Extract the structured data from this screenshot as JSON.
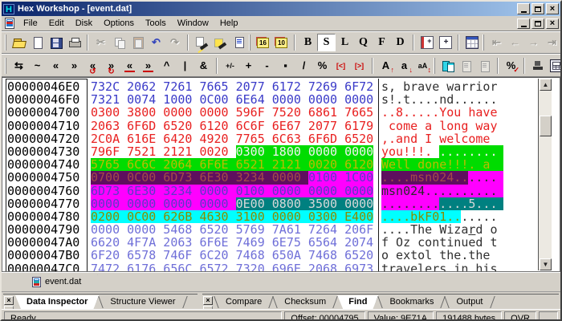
{
  "window": {
    "title": "Hex Workshop - [event.dat]",
    "logo_letter": "H"
  },
  "menu": {
    "items": [
      "File",
      "Edit",
      "Disk",
      "Options",
      "Tools",
      "Window",
      "Help"
    ]
  },
  "doc_tab": {
    "label": "event.dat"
  },
  "colors": {
    "title_gradient_left": "#0a246a",
    "title_gradient_right": "#a6caf0",
    "chrome": "#d4d0c8",
    "hex_blue": "#3a3ac8",
    "hex_periwinkle": "#6f6fd8",
    "hex_red": "#e82020",
    "green_bg": "#00dc00",
    "green_text_yellow": "#bcbc00",
    "magenta_bg": "#ff00ff",
    "magenta_text": "#5a3ac8",
    "purple_bg": "#5e0f5e",
    "purple_text": "#a34a4a",
    "teal_bg": "#008080",
    "teal_text": "#d8d8d8",
    "cyan_bg": "#00ffff",
    "cyan_text": "#8a8a00",
    "ascii_dim": "#303030"
  },
  "toolbar_row1": [
    {
      "k": "grip"
    },
    {
      "n": "open-button",
      "i": "open"
    },
    {
      "n": "new-button",
      "i": "new"
    },
    {
      "n": "save-button",
      "i": "save"
    },
    {
      "n": "print-button",
      "i": "print"
    },
    {
      "k": "sep"
    },
    {
      "n": "cut-button",
      "g": "✂",
      "d": 1
    },
    {
      "n": "copy-button",
      "i": "copy",
      "d": 1
    },
    {
      "n": "paste-button",
      "i": "paste",
      "d": 1
    },
    {
      "n": "undo-button",
      "g": "↶",
      "c": "#3344bb"
    },
    {
      "n": "redo-button",
      "g": "↷",
      "d": 1
    },
    {
      "k": "sep"
    },
    {
      "n": "find-button",
      "i": "flash"
    },
    {
      "n": "replace-button",
      "i": "flash2"
    },
    {
      "n": "copy-special-button",
      "i": "copyspec"
    },
    {
      "k": "grip"
    },
    {
      "n": "hex-base-button",
      "k": "box",
      "g": "16"
    },
    {
      "n": "dec-base-button",
      "k": "box",
      "g": "10"
    },
    {
      "k": "sep"
    },
    {
      "n": "byte-button",
      "k": "ltr",
      "g": "B"
    },
    {
      "n": "short-button",
      "k": "ltr",
      "g": "S",
      "p": 1
    },
    {
      "n": "long-button",
      "k": "ltr",
      "g": "L"
    },
    {
      "n": "quad-button",
      "k": "ltr",
      "g": "Q"
    },
    {
      "n": "float-button",
      "k": "ltr",
      "g": "F"
    },
    {
      "n": "double-button",
      "k": "ltr",
      "g": "D"
    },
    {
      "k": "sep"
    },
    {
      "n": "insert-remove-button",
      "i": "bookpm"
    },
    {
      "n": "insert-button",
      "i": "bookp"
    },
    {
      "k": "sep"
    },
    {
      "n": "grid-view-button",
      "i": "grid"
    },
    {
      "k": "grip"
    },
    {
      "n": "goto-first-button",
      "g": "⇤",
      "d": 1
    },
    {
      "n": "go-back-button",
      "g": "←",
      "d": 1
    },
    {
      "n": "go-forward-button",
      "g": "→",
      "d": 1
    },
    {
      "n": "goto-last-button",
      "g": "⇥",
      "d": 1
    }
  ],
  "toolbar_row2": [
    {
      "k": "grip"
    },
    {
      "n": "swap-bytes-button",
      "g": "⇆"
    },
    {
      "n": "not-button",
      "g": "~"
    },
    {
      "n": "shift-left-button",
      "g": "«"
    },
    {
      "n": "shift-right-button",
      "g": "»"
    },
    {
      "n": "rotate-left-button",
      "g": "«",
      "ab": "↺"
    },
    {
      "n": "rotate-right-button",
      "g": "»",
      "ab": "↻"
    },
    {
      "n": "roll-left-button",
      "g": "«",
      "ul": 1
    },
    {
      "n": "roll-right-button",
      "g": "»",
      "ul": 1
    },
    {
      "n": "xor-button",
      "g": "^"
    },
    {
      "n": "or-button",
      "g": "|"
    },
    {
      "n": "and-button",
      "g": "&"
    },
    {
      "k": "sep"
    },
    {
      "n": "negate-button",
      "g": "+/-",
      "sm": 1
    },
    {
      "n": "add-button",
      "g": "+"
    },
    {
      "n": "subtract-button",
      "g": "-"
    },
    {
      "n": "multiply-button",
      "g": "▪"
    },
    {
      "n": "divide-button",
      "g": "/"
    },
    {
      "n": "modulus-button",
      "g": "%"
    },
    {
      "n": "block-shift-left-button",
      "g": "[<]",
      "sm": 1,
      "red": 1
    },
    {
      "n": "block-shift-right-button",
      "g": "[>]",
      "sm": 1,
      "red": 1
    },
    {
      "k": "sep"
    },
    {
      "n": "uppercase-button",
      "g": "A",
      "a": "↑"
    },
    {
      "n": "lowercase-button",
      "g": "a",
      "a": "↓"
    },
    {
      "n": "toggle-case-button",
      "g": "aA",
      "sm": 1,
      "a": "↕"
    },
    {
      "k": "grip"
    },
    {
      "n": "compare-files-button",
      "i": "compare"
    },
    {
      "n": "compare-prev-button",
      "i": "comppage",
      "d": 1
    },
    {
      "n": "compare-next-button",
      "i": "comppage",
      "d": 1
    },
    {
      "k": "sep"
    },
    {
      "n": "checksum-button",
      "g": "%",
      "a": "✓"
    },
    {
      "k": "sep"
    },
    {
      "n": "smart-map-button",
      "i": "stamp"
    },
    {
      "n": "calculator-button",
      "i": "calc"
    }
  ],
  "editor": {
    "rows": [
      {
        "a": "00000046E0",
        "h": [
          [
            "732C 2062 7261 7665 2077 6172 7269 6F72",
            "blue"
          ]
        ],
        "s": [
          [
            "s, brave warrior",
            "dim"
          ]
        ]
      },
      {
        "a": "00000046F0",
        "h": [
          [
            "7321 0074 1000 0C00 6E64 0000 0000 0000",
            "blue"
          ]
        ],
        "s": [
          [
            "s!.t....nd......",
            "dim"
          ]
        ]
      },
      {
        "a": "0000004700",
        "h": [
          [
            "0300 3800 0000 0000 596F 7520 6861 7665",
            "red"
          ]
        ],
        "s": [
          [
            "..8.....You have",
            "red"
          ]
        ]
      },
      {
        "a": "0000004710",
        "h": [
          [
            "2063 6F6D 6520 6120 6C6F 6E67 2077 6179",
            "red"
          ]
        ],
        "s": [
          [
            " come a long way",
            "red"
          ]
        ]
      },
      {
        "a": "0000004720",
        "h": [
          [
            "2C0A 616E 6420 4920 7765 6C63 6F6D 6520",
            "red"
          ]
        ],
        "s": [
          [
            ",.and I welcome ",
            "red"
          ]
        ]
      },
      {
        "a": "0000004730",
        "h": [
          [
            "796F 7521 2121 0020 ",
            "red"
          ],
          [
            "0300 1800 0000 0000",
            "gw",
            "f"
          ]
        ],
        "s": [
          [
            "you!!!. ",
            "red"
          ],
          [
            "........",
            "gw",
            "f"
          ]
        ]
      },
      {
        "a": "0000004740",
        "h": [
          [
            "5765 6C6C 2064 6F6E 6521 2121 0020 6120",
            "gy",
            "f"
          ]
        ],
        "s": [
          [
            "Well done!!!. a ",
            "gy",
            "f"
          ]
        ]
      },
      {
        "a": "0000004750",
        "h": [
          [
            "0700 0C00 6D73 6E30 3234 0000 ",
            "pm"
          ],
          [
            "0100 1C00",
            "mv",
            "f"
          ]
        ],
        "s": [
          [
            "....msn024..",
            "pm"
          ],
          [
            "....",
            "md",
            "f"
          ]
        ]
      },
      {
        "a": "0000004760",
        "h": [
          [
            "6D73 6E30 3234 0000 0100 0000 0000 0000",
            "mv",
            "f"
          ]
        ],
        "s": [
          [
            "msn024..........",
            "md",
            "f"
          ]
        ]
      },
      {
        "a": "0000004770",
        "h": [
          [
            "0000 0000 0000 0000 ",
            "mv"
          ],
          [
            "0E00 0800 3500 0000",
            "tl",
            "f"
          ]
        ],
        "s": [
          [
            "........",
            "md"
          ],
          [
            "....5...",
            "tl",
            "f"
          ]
        ]
      },
      {
        "a": "0000004780",
        "h": [
          [
            "0200 0C00 626B 4630 3100 0000 0300 E400",
            "co",
            "f"
          ]
        ],
        "s": [
          [
            "....bkF01..",
            "co"
          ],
          [
            ".....",
            "dim"
          ]
        ]
      },
      {
        "a": "0000004790",
        "h": [
          [
            "0000 0000 5468 6520 5769 7A61 7264 206F",
            "peri"
          ]
        ],
        "s": [
          [
            "....The Wiza",
            "dim"
          ],
          [
            "r",
            "dim",
            "u"
          ],
          [
            "d o",
            "dim"
          ]
        ]
      },
      {
        "a": "00000047A0",
        "h": [
          [
            "6620 4F7A 2063 6F6E 7469 6E75 6564 2074",
            "peri"
          ]
        ],
        "s": [
          [
            "f Oz continued t",
            "dim"
          ]
        ]
      },
      {
        "a": "00000047B0",
        "h": [
          [
            "6F20 6578 746F 6C20 7468 650A 7468 6520",
            "peri"
          ]
        ],
        "s": [
          [
            "o extol the.the ",
            "dim"
          ]
        ]
      },
      {
        "a": "00000047C0",
        "h": [
          [
            "7472 6176 656C 6572 7320 696E 2068 6973",
            "peri"
          ]
        ],
        "s": [
          [
            "travelers in his",
            "dim"
          ]
        ]
      }
    ]
  },
  "left_panel": {
    "tabs": [
      {
        "label": "Data Inspector",
        "active": true
      },
      {
        "label": "Structure Viewer",
        "active": false
      }
    ]
  },
  "right_panel": {
    "tabs": [
      {
        "label": "Compare",
        "active": false
      },
      {
        "label": "Checksum",
        "active": false
      },
      {
        "label": "Find",
        "active": true
      },
      {
        "label": "Bookmarks",
        "active": false
      },
      {
        "label": "Output",
        "active": false
      }
    ]
  },
  "statusbar": {
    "message": "Ready",
    "segments": [
      "Offset: 00004795",
      "Value: 9E71A",
      "191488 bytes",
      "OVR",
      ""
    ]
  }
}
